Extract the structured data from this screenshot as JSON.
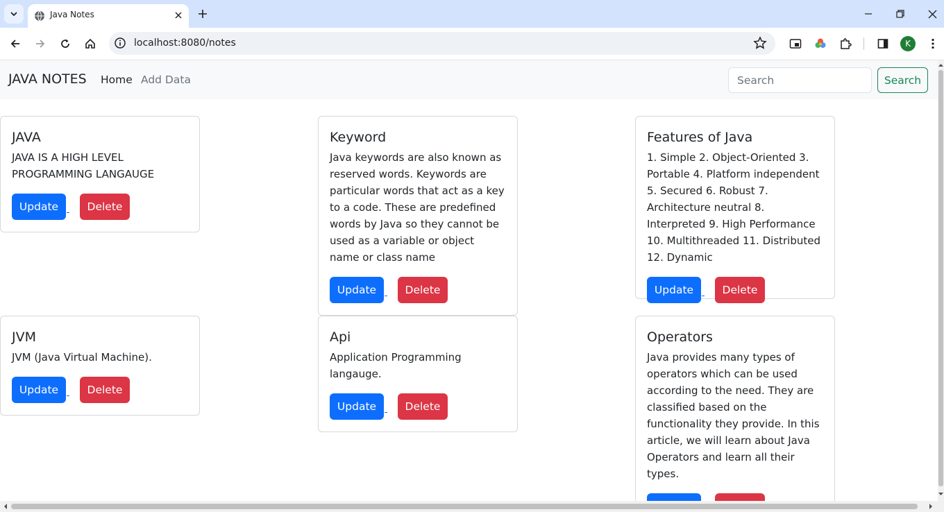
{
  "browser": {
    "tab_title": "Java Notes",
    "url": "localhost:8080/notes",
    "profile_initial": "K"
  },
  "navbar": {
    "brand": "JAVA NOTES",
    "links": [
      "Home",
      "Add Data"
    ],
    "search_placeholder": "Search",
    "search_button": "Search"
  },
  "notes": [
    {
      "title": "JAVA",
      "text": "JAVA IS A HIGH LEVEL PROGRAMMING LANGAUGE"
    },
    {
      "title": "Keyword",
      "text": "Java keywords are also known as reserved words. Keywords are particular words that act as a key to a code. These are predefined words by Java so they cannot be used as a variable or object name or class name"
    },
    {
      "title": "Features of Java",
      "text": "1. Simple 2. Object-Oriented 3. Portable 4. Platform independent 5. Secured 6. Robust 7. Architecture neutral 8. Interpreted 9. High Performance 10. Multithreaded 11. Distributed 12. Dynamic"
    },
    {
      "title": "JVM",
      "text": "JVM (Java Virtual Machine)."
    },
    {
      "title": "Api",
      "text": "Application Programming langauge."
    },
    {
      "title": "Operators",
      "text": "Java provides many types of operators which can be used according to the need. They are classified based on the functionality they provide. In this article, we will learn about Java Operators and learn all their types."
    }
  ],
  "card_buttons": {
    "update": "Update",
    "delete": "Delete"
  },
  "colors": {
    "primary": "#0d6efd",
    "danger": "#dc3545",
    "success": "#198754",
    "navbar_bg": "#f8f9fa",
    "tabbar_bg": "#d3e3fd"
  }
}
